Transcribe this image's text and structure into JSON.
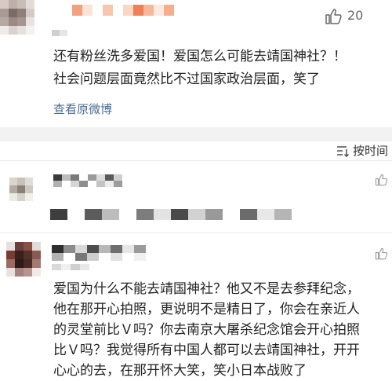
{
  "post": {
    "likes": "20",
    "text_lines": [
      "还有粉丝洗多爱国！爱国怎么可能去靖国神社？！",
      "社会问题层面竟然比不过国家政治层面，笑了"
    ],
    "view_original": "查看原微博"
  },
  "sort": {
    "label": "按时间",
    "icon": "sort-icon"
  },
  "reply": {
    "text_lines": [
      "爱国为什么不能去靖国神社？他又不是去参拜纪念，",
      "他在那开心拍照，更说明不是精日了，你会在亲近人",
      "的灵堂前比Ｖ吗？你去南京大屠杀纪念馆会开心拍照",
      "比Ｖ吗？我觉得所有中国人都可以去靖国神社，开开",
      "心心的去，在那开怀大笑，笑小日本战败了"
    ]
  },
  "colors": {
    "link": "#4a6d96",
    "gap": "#f2f2f2",
    "text": "#222222",
    "muted": "#666666"
  }
}
